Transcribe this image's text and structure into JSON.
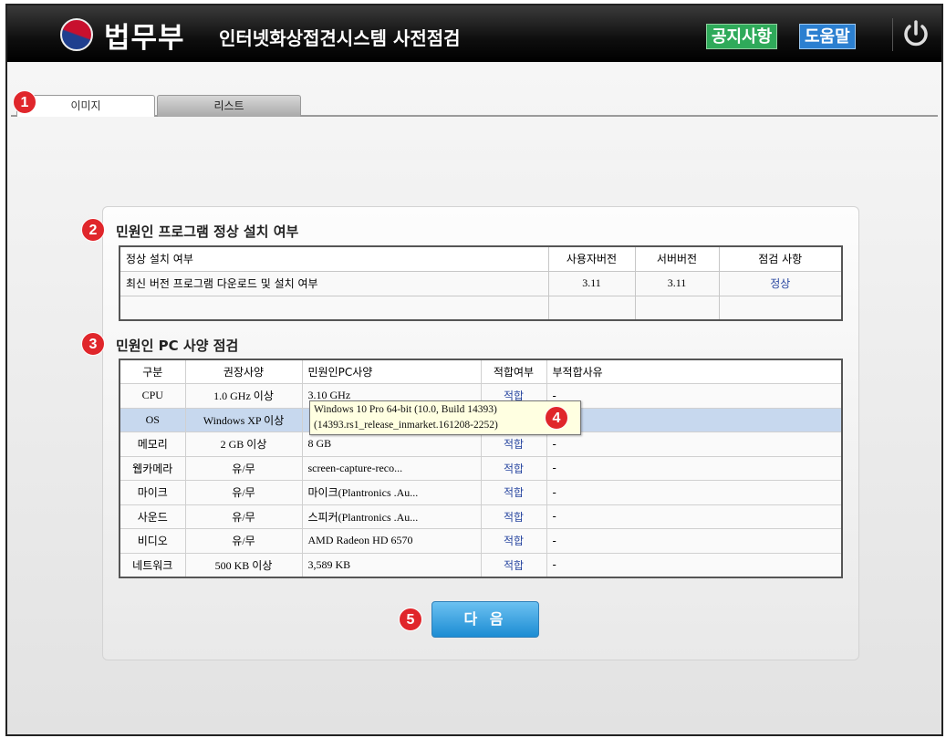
{
  "header": {
    "brand": "법무부",
    "system_title": "인터넷화상접견시스템 사전점검",
    "notice_label": "공지사항",
    "help_label": "도움말",
    "power_icon": "power-icon"
  },
  "tabs": [
    {
      "label": "이미지",
      "selected": true
    },
    {
      "label": "리스트",
      "selected": false
    }
  ],
  "markers": [
    "1",
    "2",
    "3",
    "4",
    "5"
  ],
  "program_check": {
    "title": "민원인 프로그램 정상 설치 여부",
    "headers": [
      "정상 설치 여부",
      "사용자버전",
      "서버버전",
      "점검 사항"
    ],
    "rows": [
      {
        "item": "최신 버전 프로그램 다운로드 및 설치 여부",
        "user_version": "3.11",
        "server_version": "3.11",
        "status": "정상"
      }
    ]
  },
  "pc_check": {
    "title": "민원인 PC 사양 점검",
    "headers": [
      "구분",
      "권장사양",
      "민원인PC사양",
      "적합여부",
      "부적합사유"
    ],
    "rows": [
      {
        "category": "CPU",
        "recommended": "1.0 GHz 이상",
        "user_spec": "3.10  GHz",
        "fit": "적합",
        "reason": "-"
      },
      {
        "category": "OS",
        "recommended": "Windows XP 이상",
        "user_spec": "",
        "fit": "",
        "reason": ""
      },
      {
        "category": "메모리",
        "recommended": "2 GB 이상",
        "user_spec": "8 GB",
        "fit": "적합",
        "reason": "-"
      },
      {
        "category": "웹카메라",
        "recommended": "유/무",
        "user_spec": "screen-capture-reco...",
        "fit": "적합",
        "reason": "-"
      },
      {
        "category": "마이크",
        "recommended": "유/무",
        "user_spec": "마이크(Plantronics .Au...",
        "fit": "적합",
        "reason": "-"
      },
      {
        "category": "사운드",
        "recommended": "유/무",
        "user_spec": "스피커(Plantronics .Au...",
        "fit": "적합",
        "reason": "-"
      },
      {
        "category": "비디오",
        "recommended": "유/무",
        "user_spec": "AMD Radeon HD 6570",
        "fit": "적합",
        "reason": "-"
      },
      {
        "category": "네트워크",
        "recommended": "500 KB 이상",
        "user_spec": "3,589 KB",
        "fit": "적합",
        "reason": "-"
      }
    ],
    "tooltip_line1": "Windows 10 Pro 64-bit (10.0, Build 14393)",
    "tooltip_line2": "(14393.rs1_release_inmarket.161208-2252)"
  },
  "next_button": "다 음"
}
